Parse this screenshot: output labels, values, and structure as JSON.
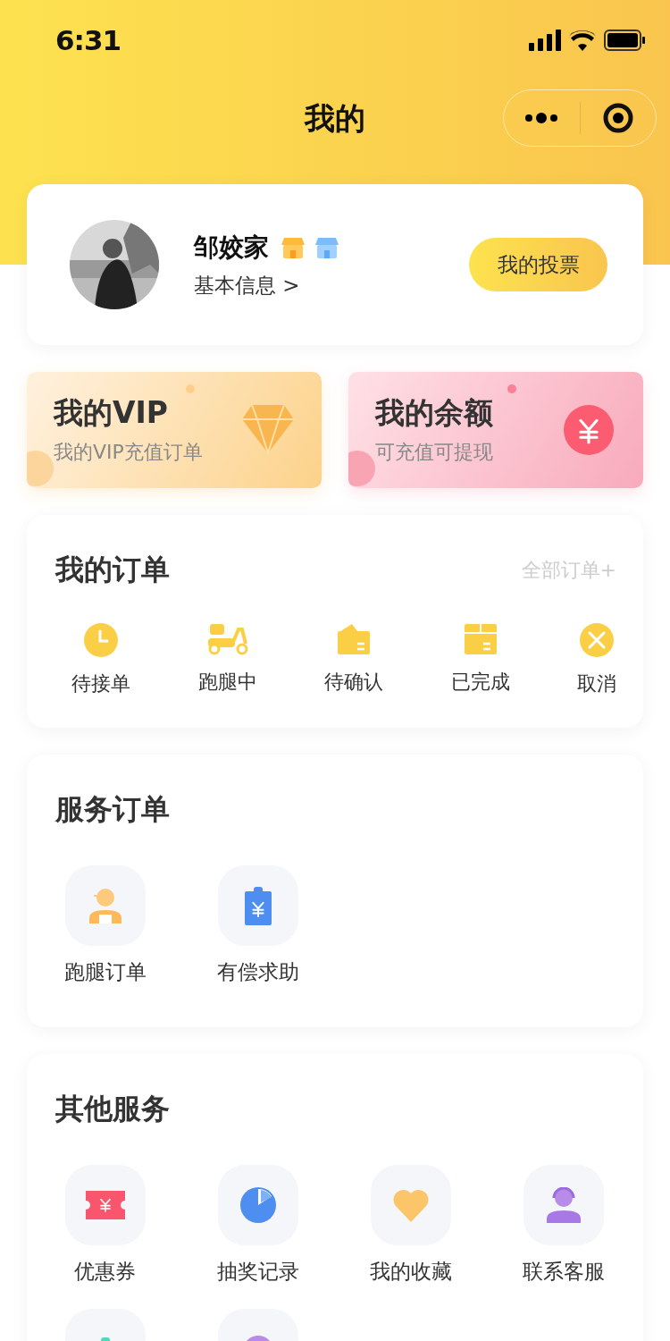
{
  "status_bar": {
    "time": "6:31"
  },
  "nav": {
    "title": "我的"
  },
  "profile": {
    "name": "邹姣家",
    "info_link": "基本信息 >",
    "vote_button": "我的投票"
  },
  "promo_cards": [
    {
      "kind": "vip",
      "title": "我的VIP",
      "subtitle": "我的VIP充值订单"
    },
    {
      "kind": "balance",
      "title": "我的余额",
      "subtitle": "可充值可提现"
    }
  ],
  "my_orders": {
    "title": "我的订单",
    "all_link": "全部订单+",
    "items": [
      {
        "label": "待接单"
      },
      {
        "label": "跑腿中"
      },
      {
        "label": "待确认"
      },
      {
        "label": "已完成"
      },
      {
        "label": "取消"
      }
    ]
  },
  "service_orders": {
    "title": "服务订单",
    "items": [
      {
        "kind": "labeled",
        "label": "跑腿订单"
      },
      {
        "kind": "labeled",
        "label": "有偿求助"
      }
    ]
  },
  "other_services": {
    "title": "其他服务",
    "items": [
      {
        "kind": "labeled",
        "label": "优惠券"
      },
      {
        "kind": "labeled",
        "label": "抽奖记录"
      },
      {
        "kind": "labeled",
        "label": "我的收藏"
      },
      {
        "kind": "labeled",
        "label": "联系客服"
      },
      {
        "kind": "icon-only"
      },
      {
        "kind": "icon-only"
      }
    ]
  }
}
